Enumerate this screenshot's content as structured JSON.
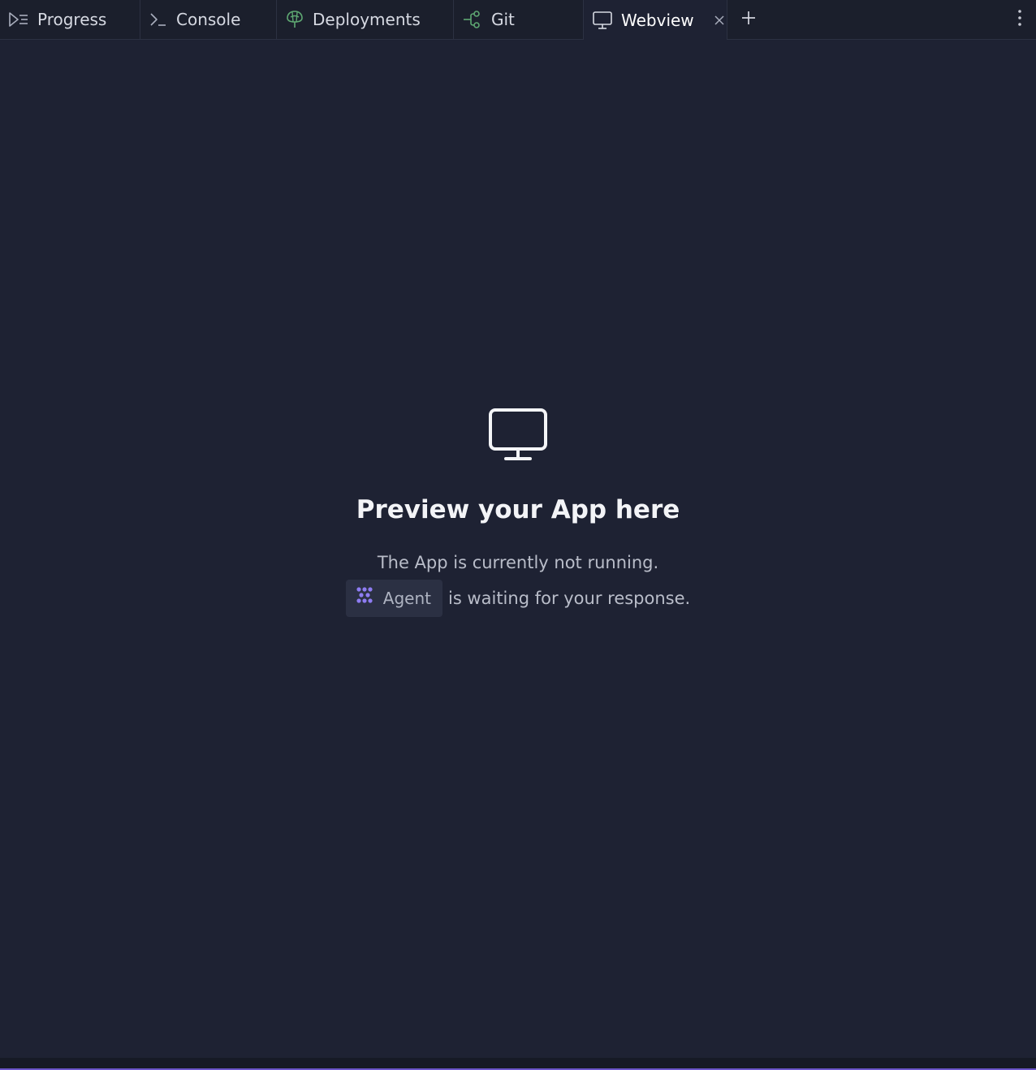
{
  "tabs": [
    {
      "label": "Progress",
      "icon": "progress-icon"
    },
    {
      "label": "Console",
      "icon": "console-icon"
    },
    {
      "label": "Deployments",
      "icon": "deployments-icon"
    },
    {
      "label": "Git",
      "icon": "git-icon"
    },
    {
      "label": "Webview",
      "icon": "monitor-icon",
      "active": true
    }
  ],
  "empty_state": {
    "icon": "monitor-icon",
    "title": "Preview your App here",
    "line1": "The App is currently not running.",
    "agent_label": "Agent",
    "line2_suffix": "is waiting for your response."
  },
  "colors": {
    "background": "#1e2233",
    "tabbar": "#1b1f2c",
    "deployments_icon": "#5ea772",
    "git_icon": "#5ea772",
    "agent_icon": "#8e7cf2",
    "bottom_accent": "#6b55c9"
  }
}
